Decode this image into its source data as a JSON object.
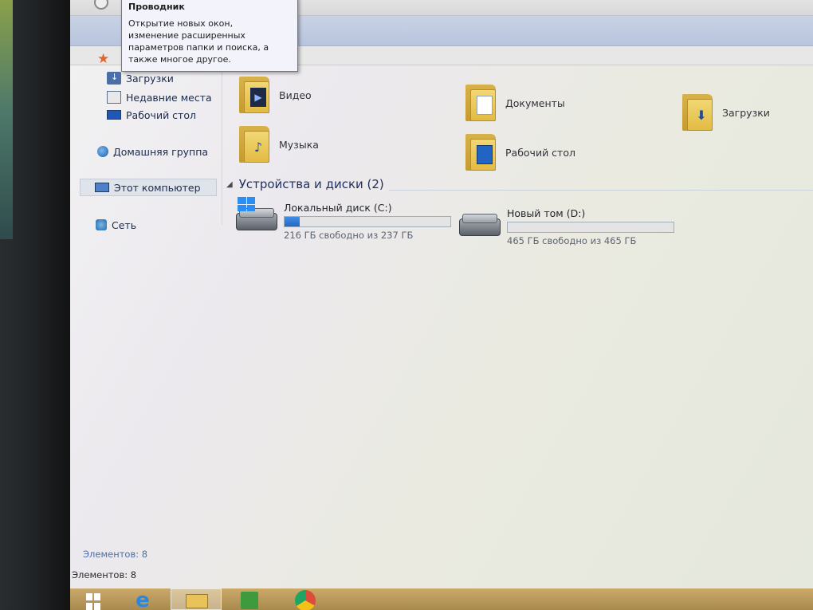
{
  "tooltip": {
    "title": "Проводник",
    "line1": "Открытие новых окон,",
    "line2": "изменение расширенных",
    "line3": "параметров папки и поиска, а",
    "line4": "также многое другое."
  },
  "nav": {
    "favorites_icon": "star-icon",
    "items": [
      {
        "label": "Загрузки",
        "icon": "downloads-icon"
      },
      {
        "label": "Недавние места",
        "icon": "recent-places-icon"
      },
      {
        "label": "Рабочий стол",
        "icon": "desktop-icon"
      },
      {
        "label": "Домашняя группа",
        "icon": "homegroup-icon"
      },
      {
        "label": "Этот компьютер",
        "icon": "computer-icon",
        "selected": true
      },
      {
        "label": "Сеть",
        "icon": "network-icon"
      }
    ]
  },
  "folders": [
    {
      "label": "Видео",
      "icon": "video-folder-icon"
    },
    {
      "label": "Документы",
      "icon": "documents-folder-icon"
    },
    {
      "label": "Загрузки",
      "icon": "downloads-folder-icon"
    },
    {
      "label": "Музыка",
      "icon": "music-folder-icon"
    },
    {
      "label": "Рабочий стол",
      "icon": "desktop-folder-icon"
    }
  ],
  "devices": {
    "heading": "Устройства и диски (2)",
    "drives": [
      {
        "name": "Локальный диск (C:)",
        "free": "216 ГБ свободно из 237 ГБ",
        "used_fraction": 0.09
      },
      {
        "name": "Новый том (D:)",
        "free": "465 ГБ свободно из 465 ГБ",
        "used_fraction": 0.0
      }
    ]
  },
  "status": {
    "items_count_nav": "Элементов: 8",
    "items_count_bar": "Элементов: 8"
  },
  "colors": {
    "accent": "#2467c2",
    "taskbar": "#b8975a"
  }
}
